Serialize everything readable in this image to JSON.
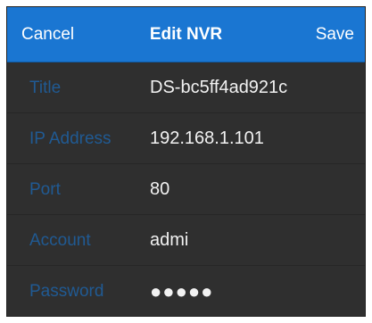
{
  "navbar": {
    "cancel_label": "Cancel",
    "title": "Edit NVR",
    "save_label": "Save"
  },
  "form": {
    "fields": [
      {
        "label": "Title",
        "value": "DS-bc5ff4ad921c"
      },
      {
        "label": "IP Address",
        "value": "192.168.1.101"
      },
      {
        "label": "Port",
        "value": "80"
      },
      {
        "label": "Account",
        "value": "admi"
      },
      {
        "label": "Password",
        "value": "●●●●●"
      }
    ]
  },
  "colors": {
    "nav_background": "#1a76d2",
    "form_background": "#2f2f2f",
    "label_text": "#1f5f9e",
    "value_text": "#f2f2f2"
  }
}
